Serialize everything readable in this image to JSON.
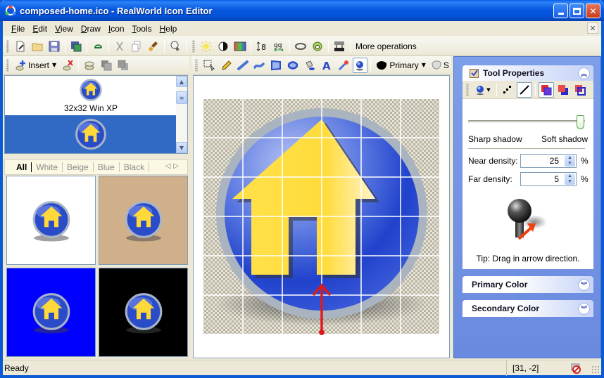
{
  "window": {
    "title": "composed-home.ico - RealWorld Icon Editor",
    "minimize_label": "_",
    "maximize_label": "□",
    "close_label": "✕"
  },
  "menu": {
    "items": [
      "File",
      "Edit",
      "View",
      "Draw",
      "Icon",
      "Tools",
      "Help"
    ],
    "mdi_close": "✕"
  },
  "main_toolbar": {
    "icons": [
      "new-icon",
      "open-icon",
      "save-icon",
      "save-as-icon",
      "undo-icon",
      "cut-icon",
      "copy-icon",
      "paste-icon",
      "lightbulb-icon",
      "brightness-icon",
      "contrast-icon",
      "hue-icon",
      "resize-icon",
      "flip-icon",
      "stroke-icon",
      "effect-icon",
      "gradient-icon"
    ],
    "more_operations": "More operations"
  },
  "format_toolbar": {
    "insert_label": "Insert"
  },
  "format_list": {
    "items": [
      {
        "label": "32x32 Win XP",
        "selected": false
      },
      {
        "label": "",
        "selected": true
      }
    ]
  },
  "preview": {
    "tabs": [
      "All",
      "White",
      "Beige",
      "Blue",
      "Black"
    ],
    "active_tab": "All",
    "backgrounds": [
      {
        "name": "white",
        "color": "#ffffff"
      },
      {
        "name": "beige",
        "color": "#d0b08a"
      },
      {
        "name": "blue",
        "color": "#0000ff"
      },
      {
        "name": "black",
        "color": "#000000"
      }
    ]
  },
  "draw_toolbar": {
    "tools": [
      "selection-tool",
      "pencil-tool",
      "line-tool",
      "curve-tool",
      "rectangle-tool",
      "ellipse-tool",
      "fill-tool",
      "text-tool",
      "color-picker-tool",
      "shadow-tool"
    ],
    "active_tool": "shadow-tool",
    "primary_label": "Primary",
    "second_label": "S"
  },
  "tool_properties": {
    "title": "Tool Properties",
    "sharp_label": "Sharp shadow",
    "soft_label": "Soft shadow",
    "softness_fraction": 1.0,
    "near_density_label": "Near density:",
    "near_density_value": "25",
    "far_density_label": "Far density:",
    "far_density_value": "5",
    "percent": "%",
    "tip": "Tip: Drag in arrow direction."
  },
  "primary_color": {
    "title": "Primary Color"
  },
  "secondary_color": {
    "title": "Secondary Color"
  },
  "status": {
    "text": "Ready",
    "coords": "[31, -2]"
  },
  "colors": {
    "accent": "#316ac5",
    "panel_blue": "#6a8ae0",
    "titlebar": "#0858e0"
  }
}
